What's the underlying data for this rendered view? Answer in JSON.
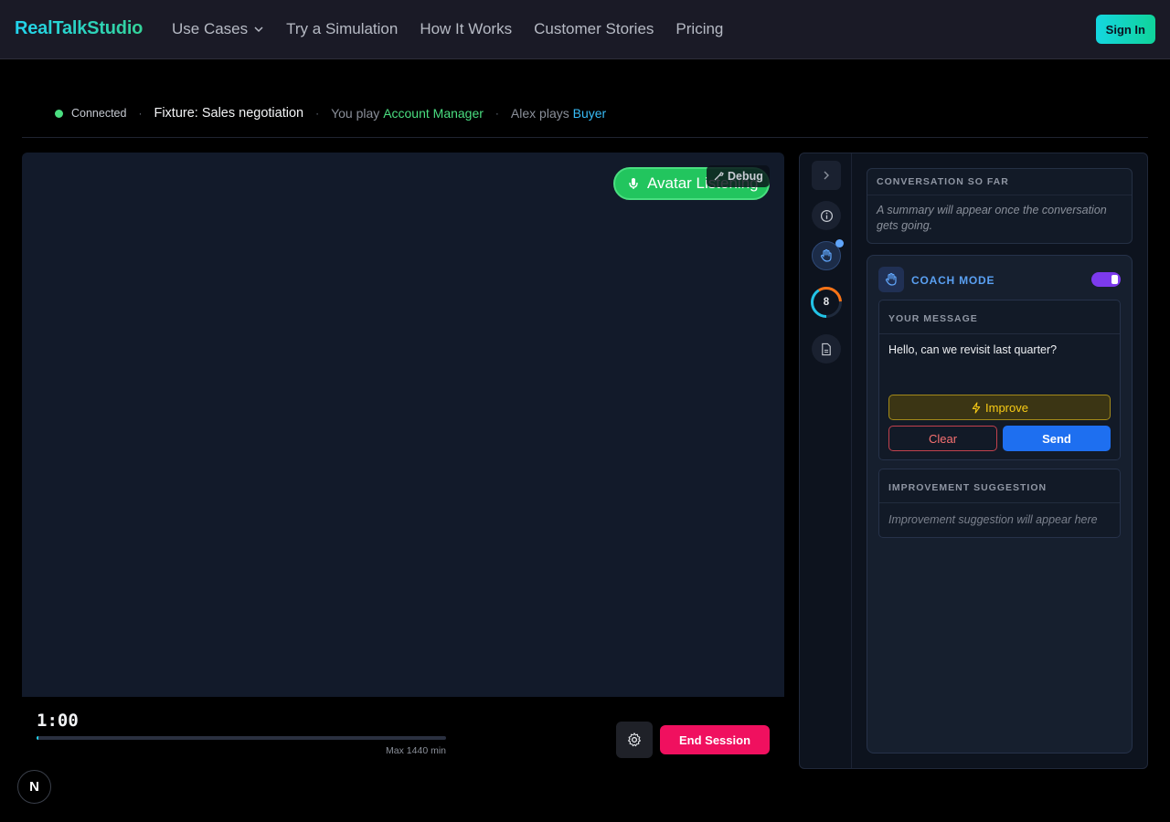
{
  "nav": {
    "brand": "RealTalkStudio",
    "links": [
      "Use Cases",
      "Try a Simulation",
      "How It Works",
      "Customer Stories",
      "Pricing"
    ],
    "signin": "Sign In"
  },
  "status": {
    "connected": "Connected",
    "fixture": "Fixture: Sales negotiation",
    "you_play_prefix": "You play",
    "you_role": "Account Manager",
    "alex_prefix": "Alex plays",
    "alex_role": "Buyer",
    "separator": "·"
  },
  "video": {
    "listening_label": "Avatar Listening",
    "debug_label": "Debug"
  },
  "controls": {
    "timer": "1:00",
    "progress_fraction": 0.004,
    "max_label": "Max 1440 min",
    "end_session": "End Session"
  },
  "rail": {
    "ring_count": "8"
  },
  "summary": {
    "title": "Conversation so far",
    "text": "A summary will appear once the conversation gets going."
  },
  "coach": {
    "title": "COACH MODE",
    "enabled": true,
    "message_title": "Your message",
    "message_text": "Hello, can we revisit last quarter?",
    "improve": "Improve",
    "clear": "Clear",
    "send": "Send",
    "suggestion_title": "Improvement suggestion",
    "suggestion_placeholder": "Improvement suggestion will appear here"
  },
  "badge": "N",
  "colors": {
    "accent_green": "#4ade80",
    "accent_cyan": "#38bdf8",
    "end_session_red": "#f0105f",
    "send_blue": "#1e6ff0",
    "toggle_purple": "#7c3aed"
  }
}
